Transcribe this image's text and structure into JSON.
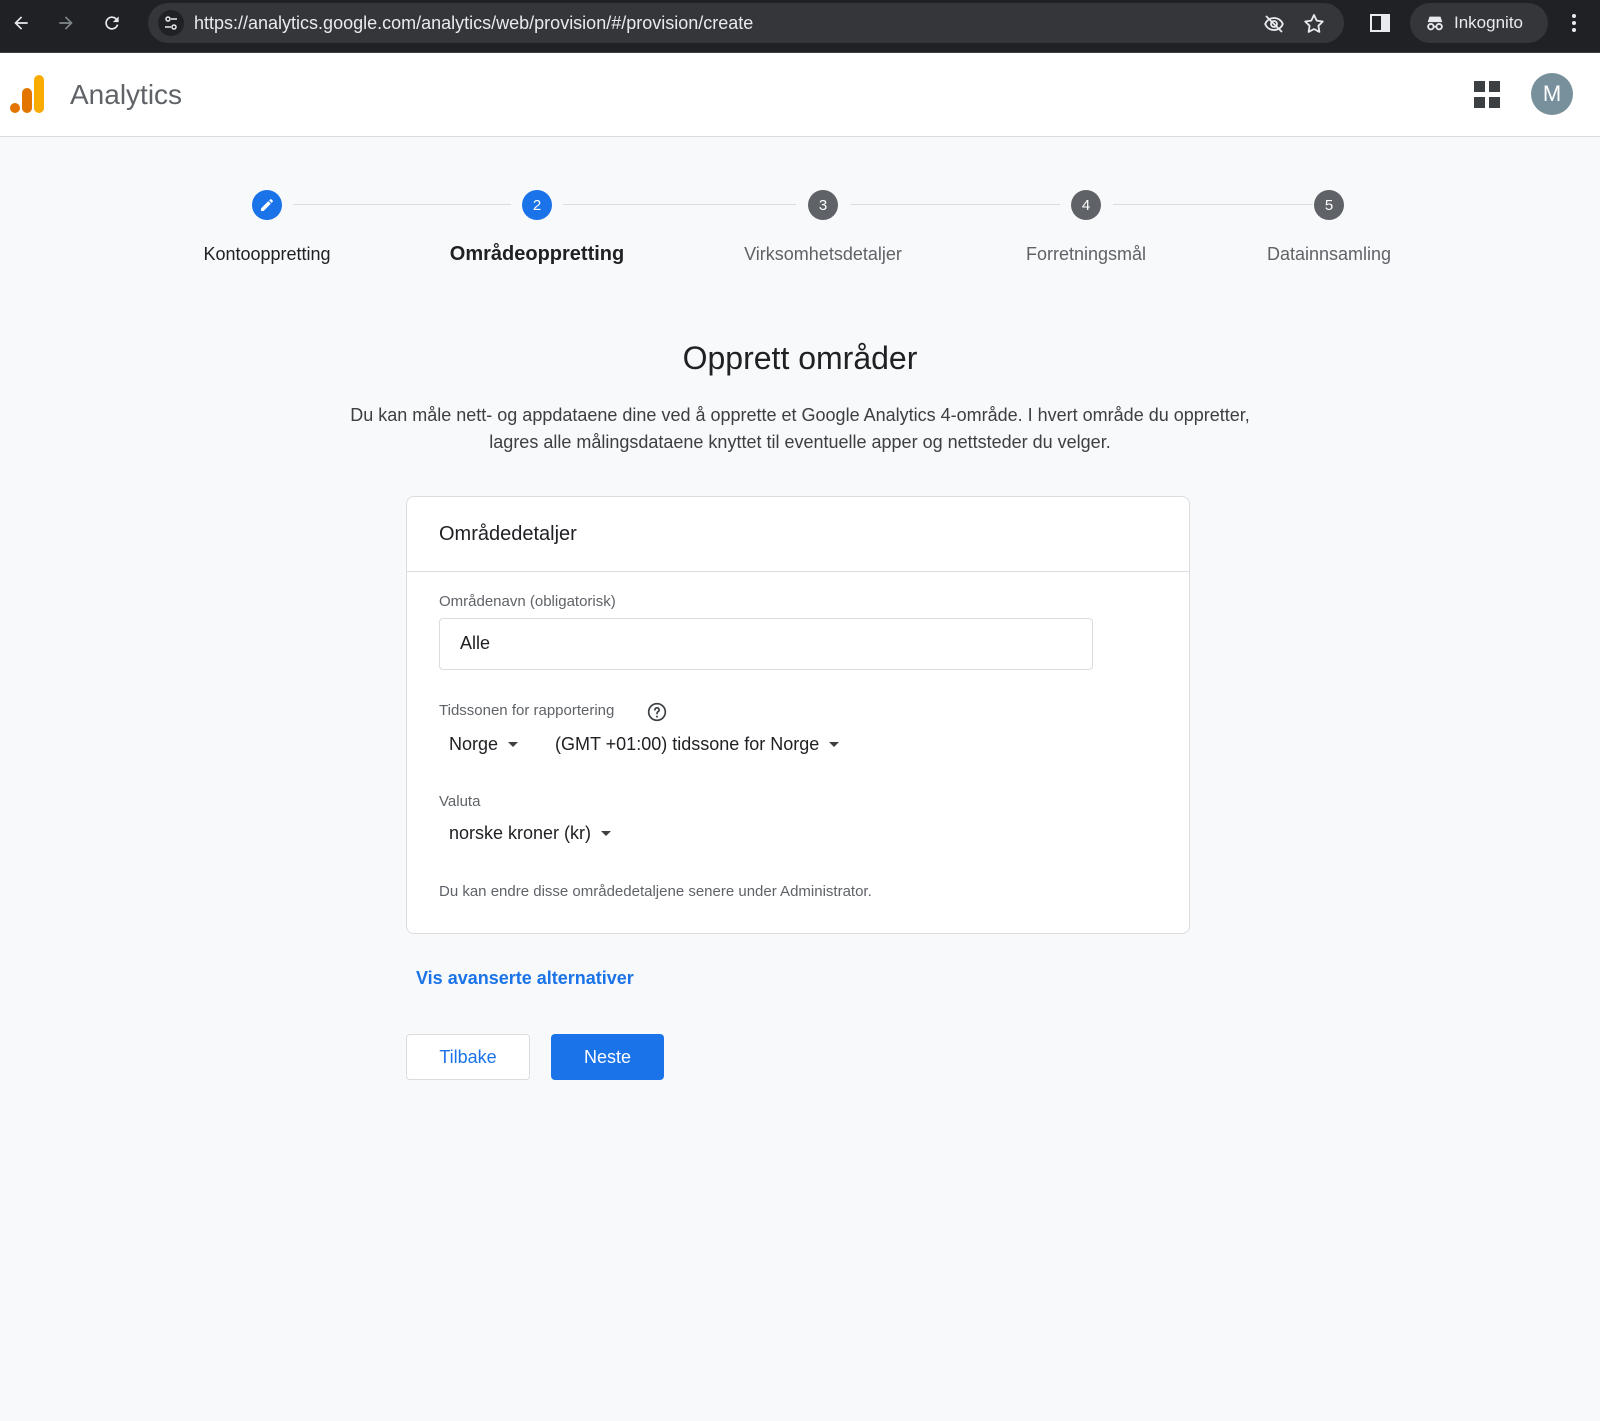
{
  "browser": {
    "url": "https://analytics.google.com/analytics/web/provision/#/provision/create",
    "incognito_label": "Inkognito"
  },
  "app": {
    "name": "Analytics",
    "avatar_initial": "M"
  },
  "stepper": {
    "steps": [
      {
        "number": "",
        "label": "Kontooppretting",
        "state": "done"
      },
      {
        "number": "2",
        "label": "Områdeoppretting",
        "state": "current"
      },
      {
        "number": "3",
        "label": "Virksomhetsdetaljer",
        "state": "todo"
      },
      {
        "number": "4",
        "label": "Forretningsmål",
        "state": "todo"
      },
      {
        "number": "5",
        "label": "Datainnsamling",
        "state": "todo"
      }
    ]
  },
  "page": {
    "title": "Opprett områder",
    "description_line1": "Du kan måle nett- og appdataene dine ved å opprette et Google Analytics 4-område. I hvert område du oppretter,",
    "description_line2": "lagres alle målingsdataene knyttet til eventuelle apper og nettsteder du velger."
  },
  "card": {
    "header": "Områdedetaljer",
    "name_label": "Områdenavn (obligatorisk)",
    "name_value": "Alle",
    "timezone_label": "Tidssonen for rapportering",
    "country_value": "Norge",
    "timezone_value": "(GMT +01:00) tidssone for Norge",
    "currency_label": "Valuta",
    "currency_value": "norske kroner (kr)",
    "note": "Du kan endre disse områdedetaljene senere under Administrator."
  },
  "actions": {
    "advanced_link": "Vis avanserte alternativer",
    "back_label": "Tilbake",
    "next_label": "Neste"
  },
  "colors": {
    "accent": "#1a73e8",
    "chrome_bg": "#202124",
    "page_bg": "#f8f9fa"
  }
}
